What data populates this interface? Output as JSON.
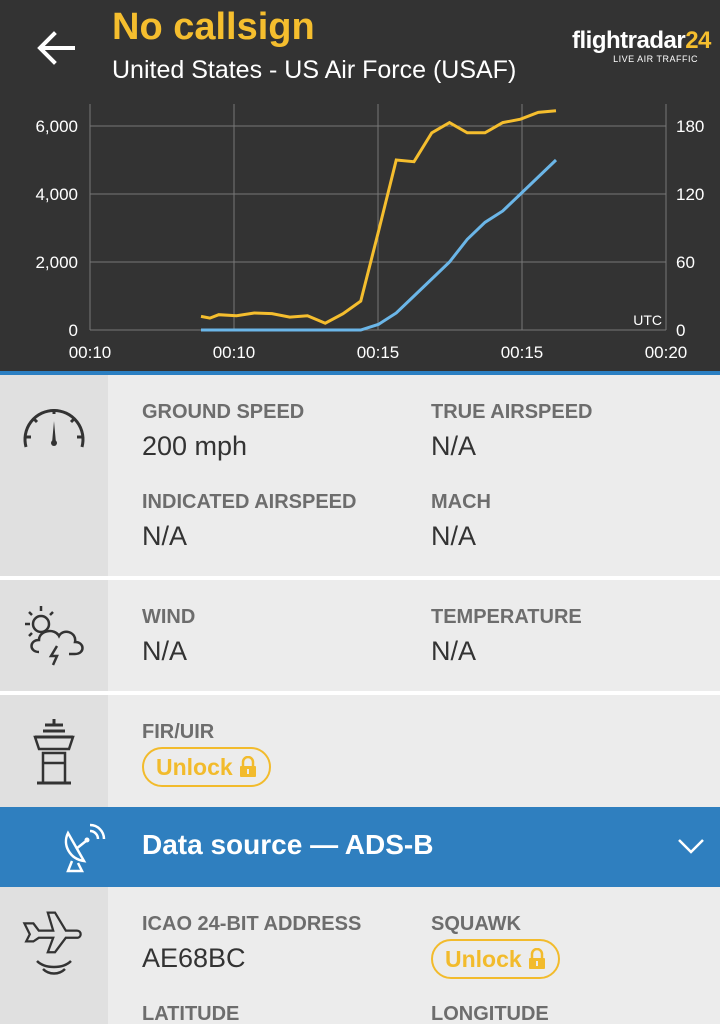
{
  "header": {
    "title": "No callsign",
    "subtitle": "United States - US Air Force (USAF)",
    "logo_text": "flightradar",
    "logo_number": "24",
    "logo_tagline": "LIVE AIR TRAFFIC"
  },
  "colors": {
    "accent_yellow": "#f5be2e",
    "accent_blue": "#2f7fbf",
    "speed_line": "#6bb6e8",
    "header_bg": "#333333"
  },
  "chart_data": {
    "type": "line",
    "x_ticks": [
      "00:10",
      "00:10",
      "00:15",
      "00:15",
      "00:20"
    ],
    "y_left_ticks": [
      "6,000",
      "4,000",
      "2,000",
      "0"
    ],
    "y_right_ticks": [
      "180",
      "120",
      "60",
      "0"
    ],
    "ylim_left": [
      0,
      6000
    ],
    "ylim_right": [
      0,
      180
    ],
    "grid": true,
    "axis_note": "UTC",
    "x": [
      0.0,
      0.025,
      0.05,
      0.1,
      0.15,
      0.2,
      0.25,
      0.3,
      0.35,
      0.4,
      0.45,
      0.5,
      0.55,
      0.6,
      0.65,
      0.7,
      0.75,
      0.8,
      0.85,
      0.9,
      0.95,
      1.0
    ],
    "series": [
      {
        "values": [
          400,
          350,
          450,
          420,
          500,
          480,
          380,
          420,
          200,
          480,
          850,
          2900,
          5000,
          4950,
          5800,
          6100,
          5800,
          5800,
          6100,
          6200,
          6400,
          6450
        ]
      },
      {
        "axis": "right",
        "values": [
          0,
          0,
          0,
          0,
          0,
          0,
          0,
          0,
          0,
          0,
          0,
          5,
          15,
          30,
          45,
          60,
          80,
          95,
          105,
          120,
          135,
          150
        ]
      }
    ]
  },
  "speed": {
    "ground_speed_label": "GROUND SPEED",
    "ground_speed_value": "200 mph",
    "true_airspeed_label": "TRUE AIRSPEED",
    "true_airspeed_value": "N/A",
    "indicated_airspeed_label": "INDICATED AIRSPEED",
    "indicated_airspeed_value": "N/A",
    "mach_label": "MACH",
    "mach_value": "N/A"
  },
  "weather": {
    "wind_label": "WIND",
    "wind_value": "N/A",
    "temperature_label": "TEMPERATURE",
    "temperature_value": "N/A"
  },
  "fir": {
    "label": "FIR/UIR",
    "unlock_label": "Unlock"
  },
  "data_source": {
    "label": "Data source — ADS-B"
  },
  "adsb": {
    "icao_label": "ICAO 24-BIT ADDRESS",
    "icao_value": "AE68BC",
    "squawk_label": "SQUAWK",
    "squawk_unlock_label": "Unlock",
    "latitude_label": "LATITUDE",
    "longitude_label": "LONGITUDE"
  }
}
